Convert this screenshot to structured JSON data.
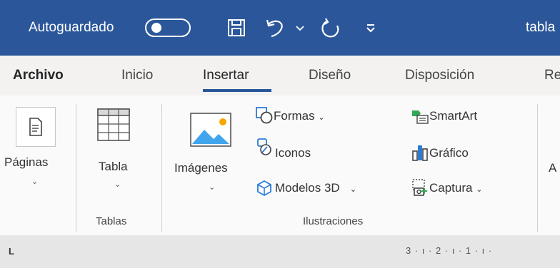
{
  "titlebar": {
    "autosave_label": "Autoguardado",
    "doc_title": "tabla"
  },
  "tabs": [
    {
      "label": "Archivo"
    },
    {
      "label": "Inicio"
    },
    {
      "label": "Insertar"
    },
    {
      "label": "Diseño"
    },
    {
      "label": "Disposición"
    },
    {
      "label": "Re"
    }
  ],
  "ribbon": {
    "paginas": "Páginas",
    "tabla": "Tabla",
    "tablas_group": "Tablas",
    "imagenes": "Imágenes",
    "formas": "Formas",
    "iconos": "Iconos",
    "modelos3d": "Modelos 3D",
    "smartart": "SmartArt",
    "grafico": "Gráfico",
    "captura": "Captura",
    "ilustraciones_group": "Ilustraciones",
    "cut_label": "A"
  },
  "ruler": {
    "tab_marker": "L",
    "marks": "3 · ı · 2 · ı · 1 · ı ·"
  },
  "colors": {
    "titlebar": "#2b579a",
    "ribbon": "#fafafa",
    "tabs": "#f3f2f1"
  }
}
